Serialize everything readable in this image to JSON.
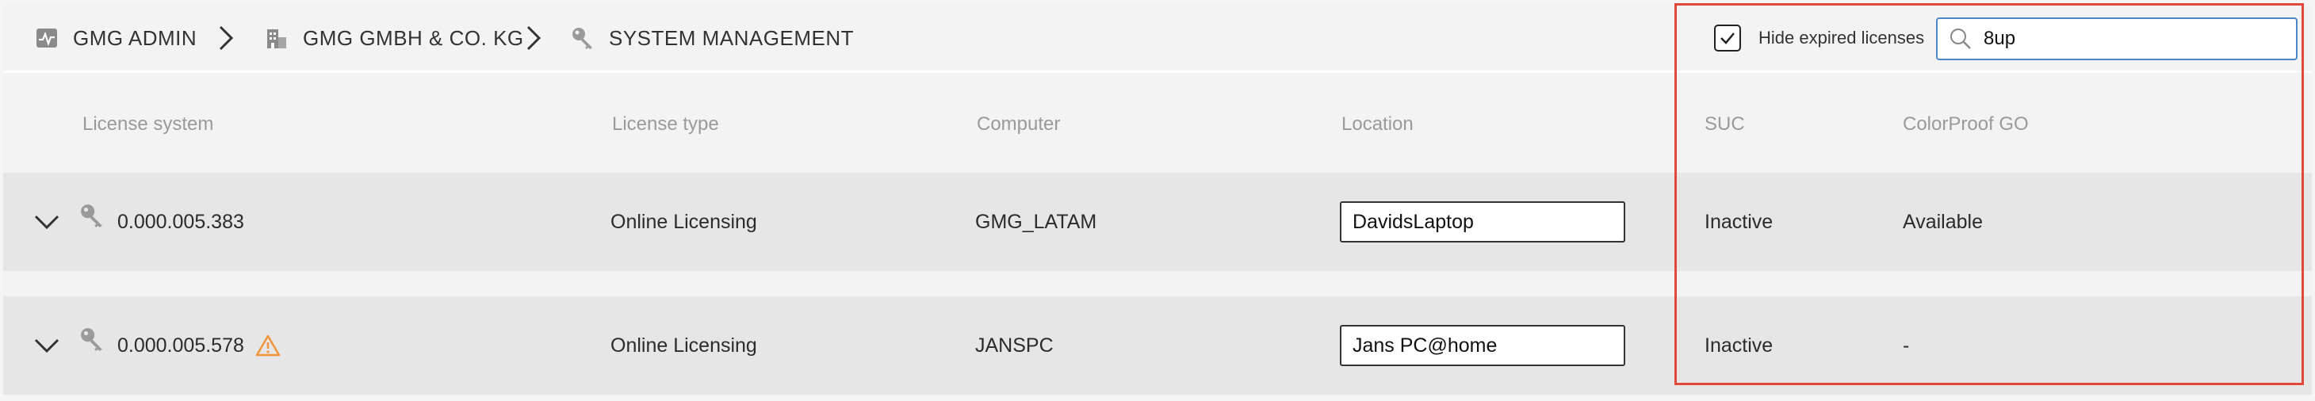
{
  "breadcrumb": {
    "items": [
      {
        "label": "GMG ADMIN",
        "icon": "activity-chart-icon"
      },
      {
        "label": "GMG GMBH & CO. KG",
        "icon": "building-icon"
      },
      {
        "label": "SYSTEM MANAGEMENT",
        "icon": "key-icon"
      }
    ]
  },
  "toolbar": {
    "hide_expired_label": "Hide expired licenses",
    "hide_expired_checked": true,
    "search_value": "8up"
  },
  "table": {
    "columns": [
      "License system",
      "License type",
      "Computer",
      "Location",
      "SUC",
      "ColorProof GO"
    ],
    "rows": [
      {
        "license_system": "0.000.005.383",
        "warning": false,
        "license_type": "Online Licensing",
        "computer": "GMG_LATAM",
        "location": "DavidsLaptop",
        "suc": "Inactive",
        "colorproof_go": "Available"
      },
      {
        "license_system": "0.000.005.578",
        "warning": true,
        "license_type": "Online Licensing",
        "computer": "JANSPC",
        "location": "Jans PC@home",
        "suc": "Inactive",
        "colorproof_go": "-"
      }
    ]
  },
  "colors": {
    "highlight": "#e0483a",
    "search_border": "#4c86c8",
    "warning": "#f0953a",
    "row_bg": "#e6e6e6"
  }
}
